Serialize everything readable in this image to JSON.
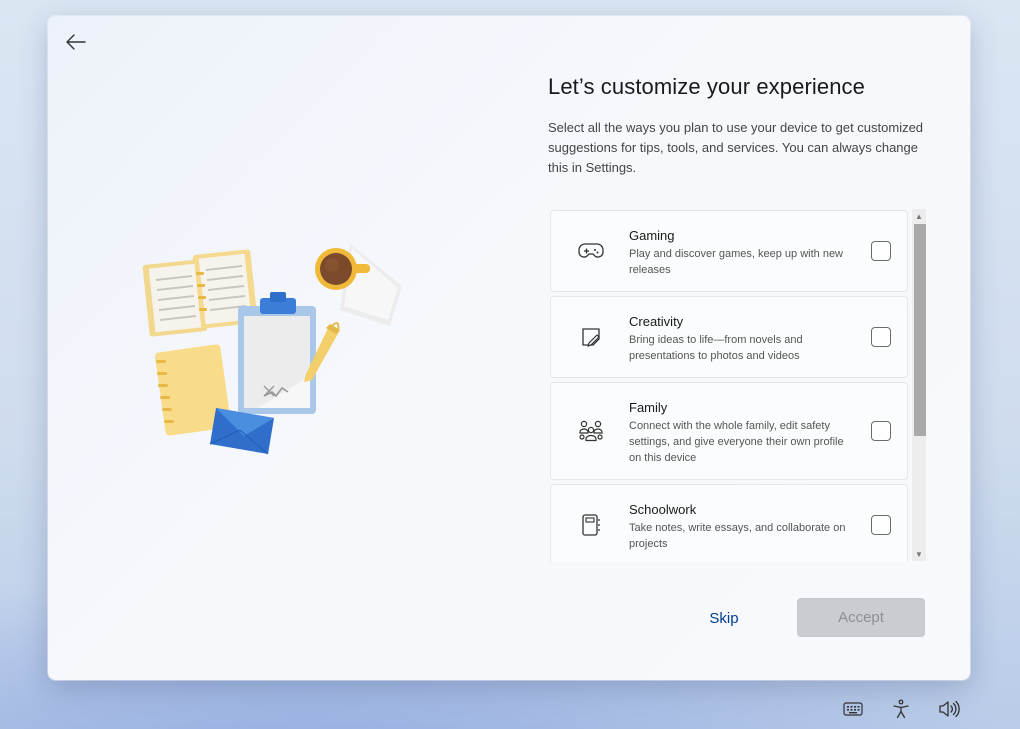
{
  "page": {
    "title": "Let’s customize your experience",
    "description": "Select all the ways you plan to use your device to get customized suggestions for tips, tools, and services. You can always change this in Settings."
  },
  "options": [
    {
      "title": "Gaming",
      "description": "Play and discover games, keep up with new releases",
      "icon": "gamepad-icon",
      "checked": false
    },
    {
      "title": "Creativity",
      "description": "Bring ideas to life—from novels and presentations to photos and videos",
      "icon": "sticky-note-pen-icon",
      "checked": false
    },
    {
      "title": "Family",
      "description": "Connect with the whole family, edit safety settings, and give everyone their own profile on this device",
      "icon": "people-group-icon",
      "checked": false
    },
    {
      "title": "Schoolwork",
      "description": "Take notes, write essays, and collaborate on projects",
      "icon": "notebook-icon",
      "checked": false
    }
  ],
  "buttons": {
    "skip_label": "Skip",
    "accept_label": "Accept",
    "accept_enabled": false
  },
  "tray": {
    "icons": [
      "keyboard-icon",
      "accessibility-icon",
      "volume-icon"
    ]
  },
  "colors": {
    "link": "#003e92",
    "accept_disabled_bg": "#c9ccd1",
    "accept_disabled_text": "#8c8f94"
  }
}
